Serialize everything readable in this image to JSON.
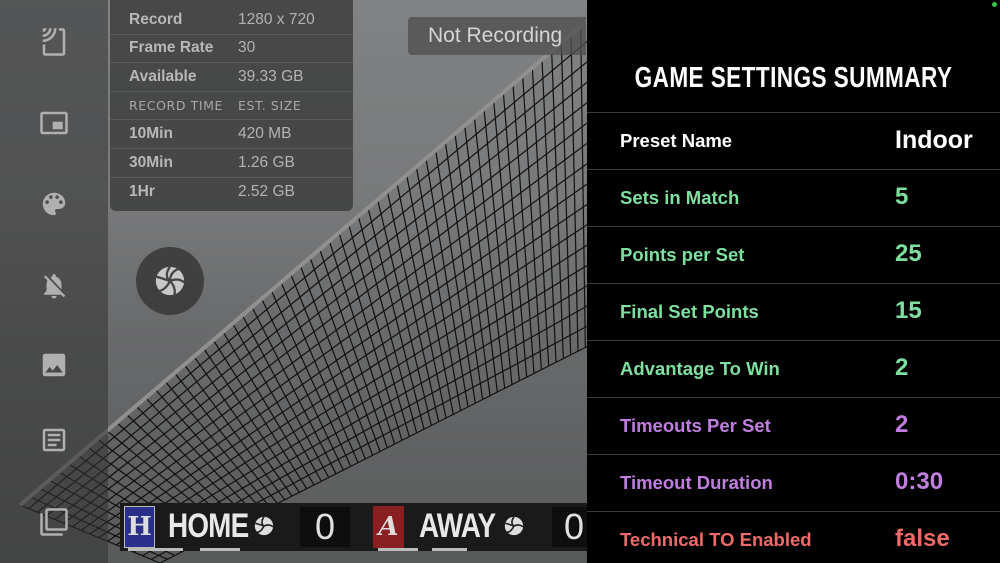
{
  "recording_info": {
    "rows": [
      {
        "key": "Record",
        "value": "1280 x 720"
      },
      {
        "key": "Frame Rate",
        "value": "30"
      },
      {
        "key": "Available",
        "value": "39.33 GB"
      }
    ],
    "table_header": {
      "key": "RECORD TIME",
      "value": "EST. SIZE"
    },
    "estimates": [
      {
        "key": "10Min",
        "value": "420 MB"
      },
      {
        "key": "30Min",
        "value": "1.26 GB"
      },
      {
        "key": "1Hr",
        "value": "2.52 GB"
      }
    ]
  },
  "status": {
    "recording_label": "Not Recording"
  },
  "sidebar": {
    "icons": [
      "cast-icon",
      "picture-in-picture-icon",
      "palette-icon",
      "notifications-off-icon",
      "image-icon",
      "article-icon",
      "copy-icon"
    ]
  },
  "scoreboard": {
    "home": {
      "logo_letter": "H",
      "name": "HOME",
      "score": "0",
      "color": "#2a2f8a"
    },
    "away": {
      "logo_letter": "A",
      "name": "AWAY",
      "score": "0",
      "color": "#8a1f22"
    }
  },
  "summary": {
    "title": "GAME SETTINGS SUMMARY",
    "rows": [
      {
        "label": "Preset Name",
        "value": "Indoor",
        "color": "#ffffff"
      },
      {
        "label": "Sets in Match",
        "value": "5",
        "color": "#7ee0a0"
      },
      {
        "label": "Points per Set",
        "value": "25",
        "color": "#7ee0a0"
      },
      {
        "label": "Final Set Points",
        "value": "15",
        "color": "#7ee0a0"
      },
      {
        "label": "Advantage To Win",
        "value": "2",
        "color": "#7ee0a0"
      },
      {
        "label": "Timeouts Per Set",
        "value": "2",
        "color": "#c07fe0"
      },
      {
        "label": "Timeout Duration",
        "value": "0:30",
        "color": "#c07fe0"
      },
      {
        "label": "Technical TO Enabled",
        "value": "false",
        "color": "#f06a6a"
      }
    ]
  }
}
